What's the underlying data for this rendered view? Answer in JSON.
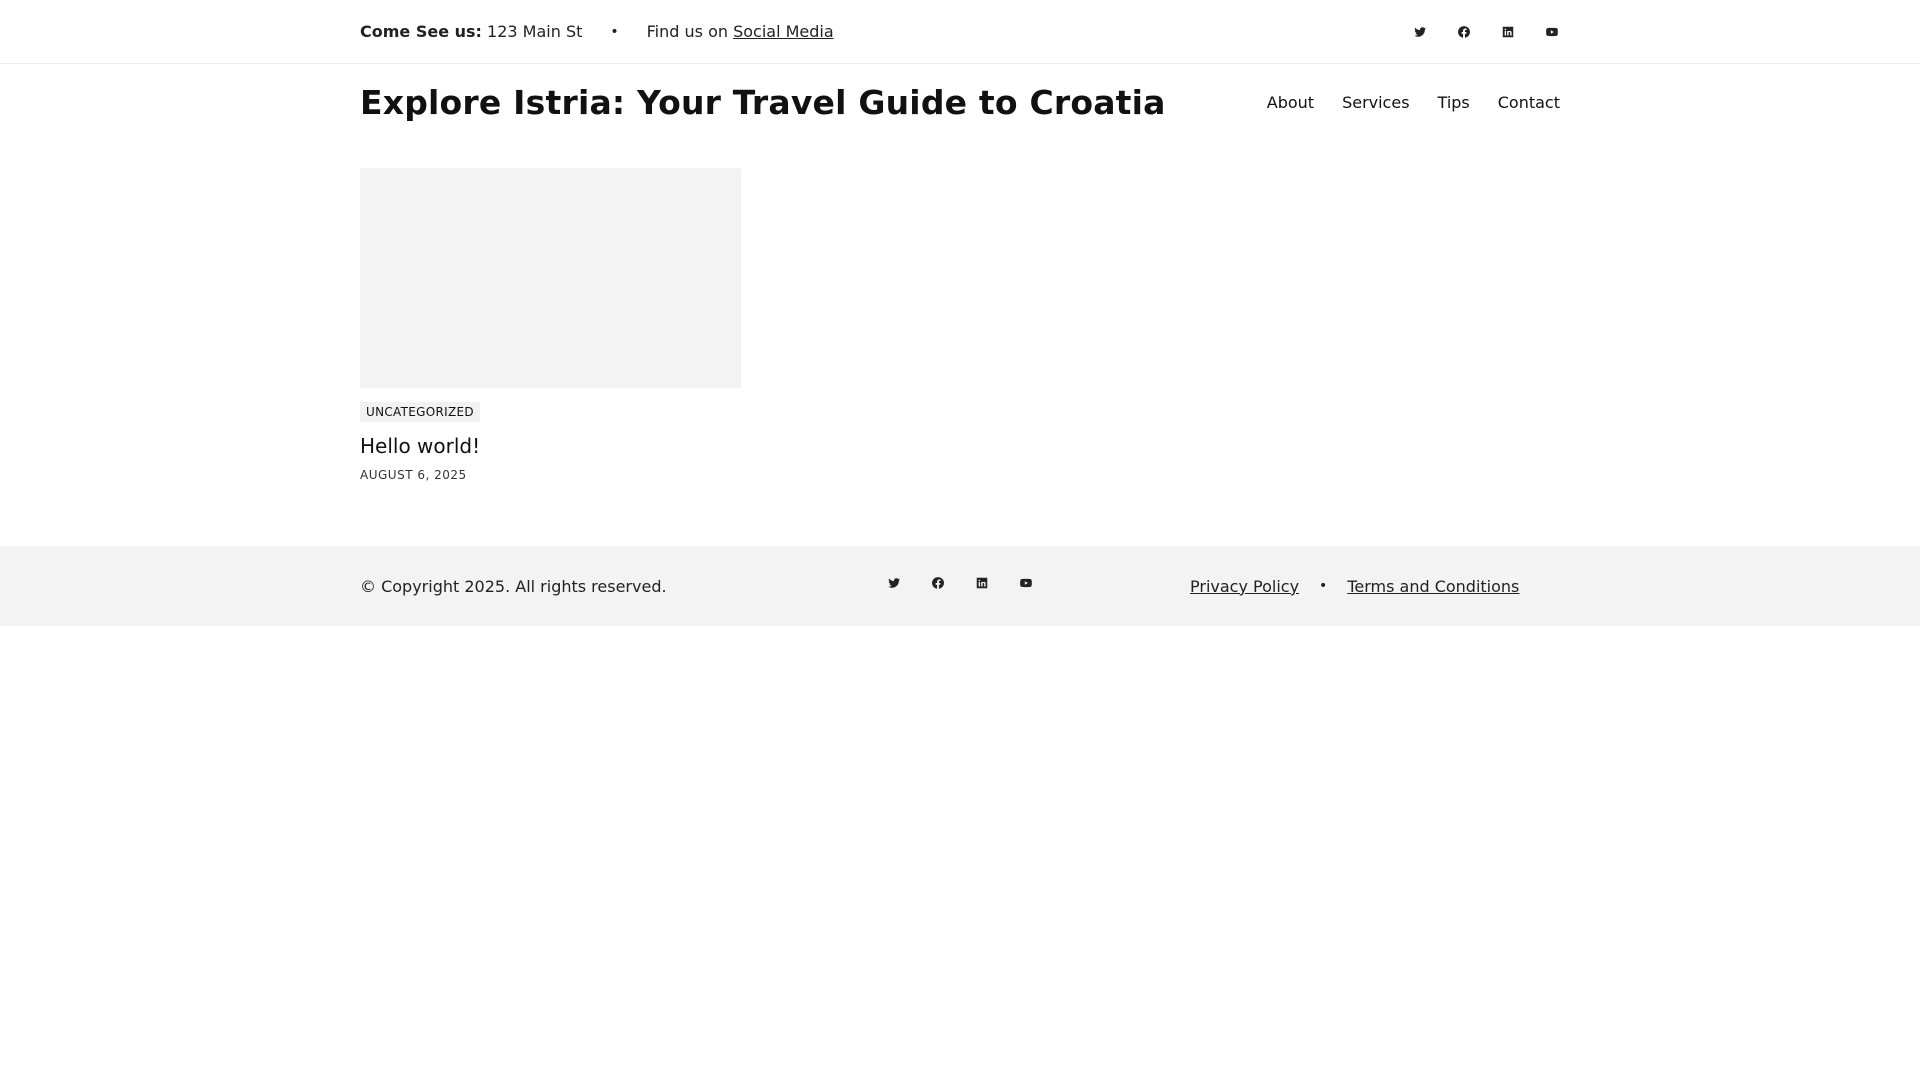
{
  "topbar": {
    "address_label": "Come See us:",
    "address_value": "123 Main St",
    "separator": "•",
    "social_prefix": "Find us on",
    "social_link": "Social Media",
    "social_icons": [
      "twitter-icon",
      "facebook-icon",
      "linkedin-icon",
      "youtube-icon"
    ]
  },
  "header": {
    "site_title": "Explore Istria: Your Travel Guide to Croatia",
    "nav": [
      "About",
      "Services",
      "Tips",
      "Contact"
    ]
  },
  "posts": [
    {
      "category": "UNCATEGORIZED",
      "title": "Hello world!",
      "date": "AUGUST 6, 2025"
    }
  ],
  "footer": {
    "copyright": "© Copyright 2025. All rights reserved.",
    "social_icons": [
      "twitter-icon",
      "facebook-icon",
      "linkedin-icon",
      "youtube-icon"
    ],
    "links": [
      "Privacy Policy",
      "Terms and Conditions"
    ],
    "separator": "•"
  },
  "colors": {
    "text": "#111111",
    "footer_bg": "#f3f3f3",
    "thumb_bg": "#f3f3f3",
    "category_bg": "#f1f1f1"
  }
}
